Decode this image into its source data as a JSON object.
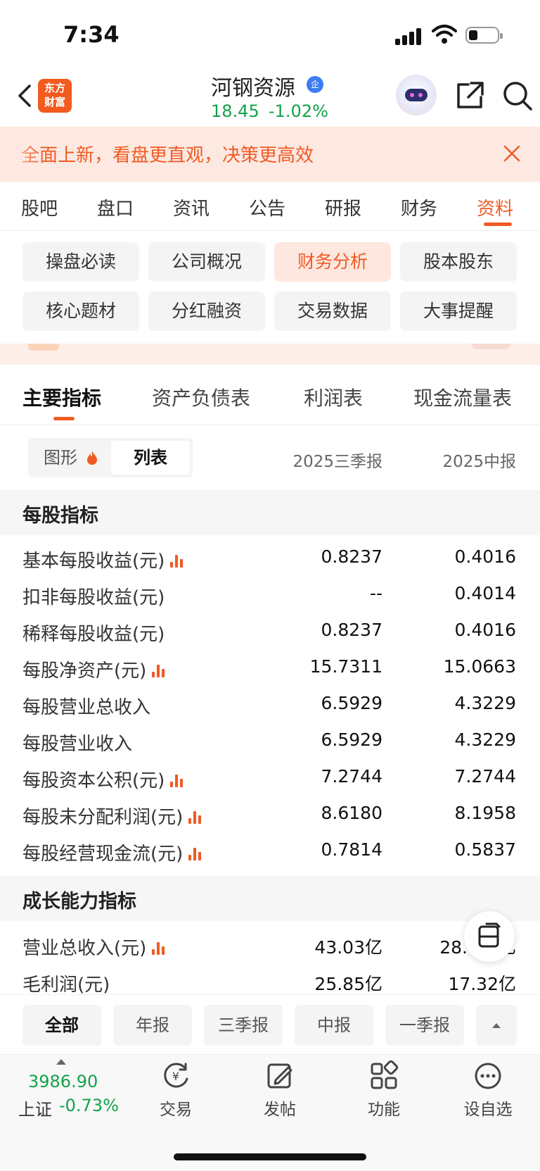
{
  "status_bar": {
    "time": "7:34"
  },
  "header": {
    "logo_line1": "东方",
    "logo_line2": "财富",
    "stock_name": "河钢资源",
    "badge": "企",
    "price": "18.45",
    "change_pct": "-1.02%"
  },
  "banner": {
    "text": "全面上新，看盘更直观，决策更高效"
  },
  "main_tabs": [
    "股吧",
    "盘口",
    "资讯",
    "公告",
    "研报",
    "财务",
    "资料"
  ],
  "active_main_tab": "资料",
  "sub_buttons": [
    "操盘必读",
    "公司概况",
    "财务分析",
    "股本股东",
    "核心题材",
    "分红融资",
    "交易数据",
    "大事提醒"
  ],
  "active_sub_button": "财务分析",
  "report_tabs": [
    "主要指标",
    "资产负债表",
    "利润表",
    "现金流量表"
  ],
  "view_toggle": {
    "graph": "图形",
    "list": "列表"
  },
  "columns": [
    "2025三季报",
    "2025中报"
  ],
  "sections": [
    {
      "title": "每股指标",
      "rows": [
        {
          "label": "基本每股收益(元)",
          "chart": true,
          "v1": "0.8237",
          "v2": "0.4016"
        },
        {
          "label": "扣非每股收益(元)",
          "chart": false,
          "v1": "--",
          "v2": "0.4014"
        },
        {
          "label": "稀释每股收益(元)",
          "chart": false,
          "v1": "0.8237",
          "v2": "0.4016"
        },
        {
          "label": "每股净资产(元)",
          "chart": true,
          "v1": "15.7311",
          "v2": "15.0663"
        },
        {
          "label": "每股营业总收入",
          "chart": false,
          "v1": "6.5929",
          "v2": "4.3229"
        },
        {
          "label": "每股营业收入",
          "chart": false,
          "v1": "6.5929",
          "v2": "4.3229"
        },
        {
          "label": "每股资本公积(元)",
          "chart": true,
          "v1": "7.2744",
          "v2": "7.2744"
        },
        {
          "label": "每股未分配利润(元)",
          "chart": true,
          "v1": "8.6180",
          "v2": "8.1958"
        },
        {
          "label": "每股经营现金流(元)",
          "chart": true,
          "v1": "0.7814",
          "v2": "0.5837"
        }
      ]
    },
    {
      "title": "成长能力指标",
      "rows": [
        {
          "label": "营业总收入(元)",
          "chart": true,
          "v1": "43.03亿",
          "v2": "28.",
          "v2_suffix": "亿"
        },
        {
          "label": "毛利润(元)",
          "chart": false,
          "v1": "25.85亿",
          "v2": "17.32亿"
        }
      ]
    }
  ],
  "filters": [
    "全部",
    "年报",
    "三季报",
    "中报",
    "一季报"
  ],
  "active_filter": "全部",
  "bottom_nav": {
    "market_value": "3986.90",
    "market_name": "上证",
    "market_change": "-0.73%",
    "items": [
      "交易",
      "发帖",
      "功能",
      "设自选"
    ]
  },
  "colors": {
    "accent": "#f15a24",
    "down": "#13a24a",
    "banner_bg": "#fde9e1"
  }
}
